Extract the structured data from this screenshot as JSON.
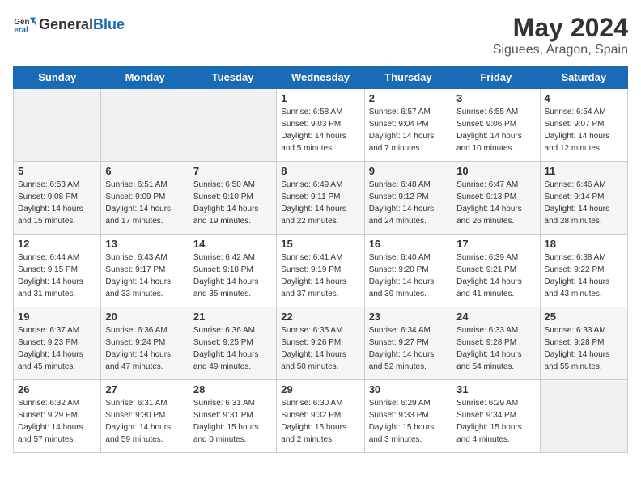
{
  "header": {
    "logo_general": "General",
    "logo_blue": "Blue",
    "month": "May 2024",
    "location": "Siguees, Aragon, Spain"
  },
  "days_of_week": [
    "Sunday",
    "Monday",
    "Tuesday",
    "Wednesday",
    "Thursday",
    "Friday",
    "Saturday"
  ],
  "weeks": [
    [
      {
        "day": "",
        "empty": true
      },
      {
        "day": "",
        "empty": true
      },
      {
        "day": "",
        "empty": true
      },
      {
        "day": "1",
        "sunrise": "6:58 AM",
        "sunset": "9:03 PM",
        "daylight": "14 hours and 5 minutes."
      },
      {
        "day": "2",
        "sunrise": "6:57 AM",
        "sunset": "9:04 PM",
        "daylight": "14 hours and 7 minutes."
      },
      {
        "day": "3",
        "sunrise": "6:55 AM",
        "sunset": "9:06 PM",
        "daylight": "14 hours and 10 minutes."
      },
      {
        "day": "4",
        "sunrise": "6:54 AM",
        "sunset": "9:07 PM",
        "daylight": "14 hours and 12 minutes."
      }
    ],
    [
      {
        "day": "5",
        "sunrise": "6:53 AM",
        "sunset": "9:08 PM",
        "daylight": "14 hours and 15 minutes."
      },
      {
        "day": "6",
        "sunrise": "6:51 AM",
        "sunset": "9:09 PM",
        "daylight": "14 hours and 17 minutes."
      },
      {
        "day": "7",
        "sunrise": "6:50 AM",
        "sunset": "9:10 PM",
        "daylight": "14 hours and 19 minutes."
      },
      {
        "day": "8",
        "sunrise": "6:49 AM",
        "sunset": "9:11 PM",
        "daylight": "14 hours and 22 minutes."
      },
      {
        "day": "9",
        "sunrise": "6:48 AM",
        "sunset": "9:12 PM",
        "daylight": "14 hours and 24 minutes."
      },
      {
        "day": "10",
        "sunrise": "6:47 AM",
        "sunset": "9:13 PM",
        "daylight": "14 hours and 26 minutes."
      },
      {
        "day": "11",
        "sunrise": "6:46 AM",
        "sunset": "9:14 PM",
        "daylight": "14 hours and 28 minutes."
      }
    ],
    [
      {
        "day": "12",
        "sunrise": "6:44 AM",
        "sunset": "9:15 PM",
        "daylight": "14 hours and 31 minutes."
      },
      {
        "day": "13",
        "sunrise": "6:43 AM",
        "sunset": "9:17 PM",
        "daylight": "14 hours and 33 minutes."
      },
      {
        "day": "14",
        "sunrise": "6:42 AM",
        "sunset": "9:18 PM",
        "daylight": "14 hours and 35 minutes."
      },
      {
        "day": "15",
        "sunrise": "6:41 AM",
        "sunset": "9:19 PM",
        "daylight": "14 hours and 37 minutes."
      },
      {
        "day": "16",
        "sunrise": "6:40 AM",
        "sunset": "9:20 PM",
        "daylight": "14 hours and 39 minutes."
      },
      {
        "day": "17",
        "sunrise": "6:39 AM",
        "sunset": "9:21 PM",
        "daylight": "14 hours and 41 minutes."
      },
      {
        "day": "18",
        "sunrise": "6:38 AM",
        "sunset": "9:22 PM",
        "daylight": "14 hours and 43 minutes."
      }
    ],
    [
      {
        "day": "19",
        "sunrise": "6:37 AM",
        "sunset": "9:23 PM",
        "daylight": "14 hours and 45 minutes."
      },
      {
        "day": "20",
        "sunrise": "6:36 AM",
        "sunset": "9:24 PM",
        "daylight": "14 hours and 47 minutes."
      },
      {
        "day": "21",
        "sunrise": "6:36 AM",
        "sunset": "9:25 PM",
        "daylight": "14 hours and 49 minutes."
      },
      {
        "day": "22",
        "sunrise": "6:35 AM",
        "sunset": "9:26 PM",
        "daylight": "14 hours and 50 minutes."
      },
      {
        "day": "23",
        "sunrise": "6:34 AM",
        "sunset": "9:27 PM",
        "daylight": "14 hours and 52 minutes."
      },
      {
        "day": "24",
        "sunrise": "6:33 AM",
        "sunset": "9:28 PM",
        "daylight": "14 hours and 54 minutes."
      },
      {
        "day": "25",
        "sunrise": "6:33 AM",
        "sunset": "9:28 PM",
        "daylight": "14 hours and 55 minutes."
      }
    ],
    [
      {
        "day": "26",
        "sunrise": "6:32 AM",
        "sunset": "9:29 PM",
        "daylight": "14 hours and 57 minutes."
      },
      {
        "day": "27",
        "sunrise": "6:31 AM",
        "sunset": "9:30 PM",
        "daylight": "14 hours and 59 minutes."
      },
      {
        "day": "28",
        "sunrise": "6:31 AM",
        "sunset": "9:31 PM",
        "daylight": "15 hours and 0 minutes."
      },
      {
        "day": "29",
        "sunrise": "6:30 AM",
        "sunset": "9:32 PM",
        "daylight": "15 hours and 2 minutes."
      },
      {
        "day": "30",
        "sunrise": "6:29 AM",
        "sunset": "9:33 PM",
        "daylight": "15 hours and 3 minutes."
      },
      {
        "day": "31",
        "sunrise": "6:29 AM",
        "sunset": "9:34 PM",
        "daylight": "15 hours and 4 minutes."
      },
      {
        "day": "",
        "empty": true
      }
    ]
  ],
  "labels": {
    "sunrise": "Sunrise:",
    "sunset": "Sunset:",
    "daylight": "Daylight:"
  }
}
